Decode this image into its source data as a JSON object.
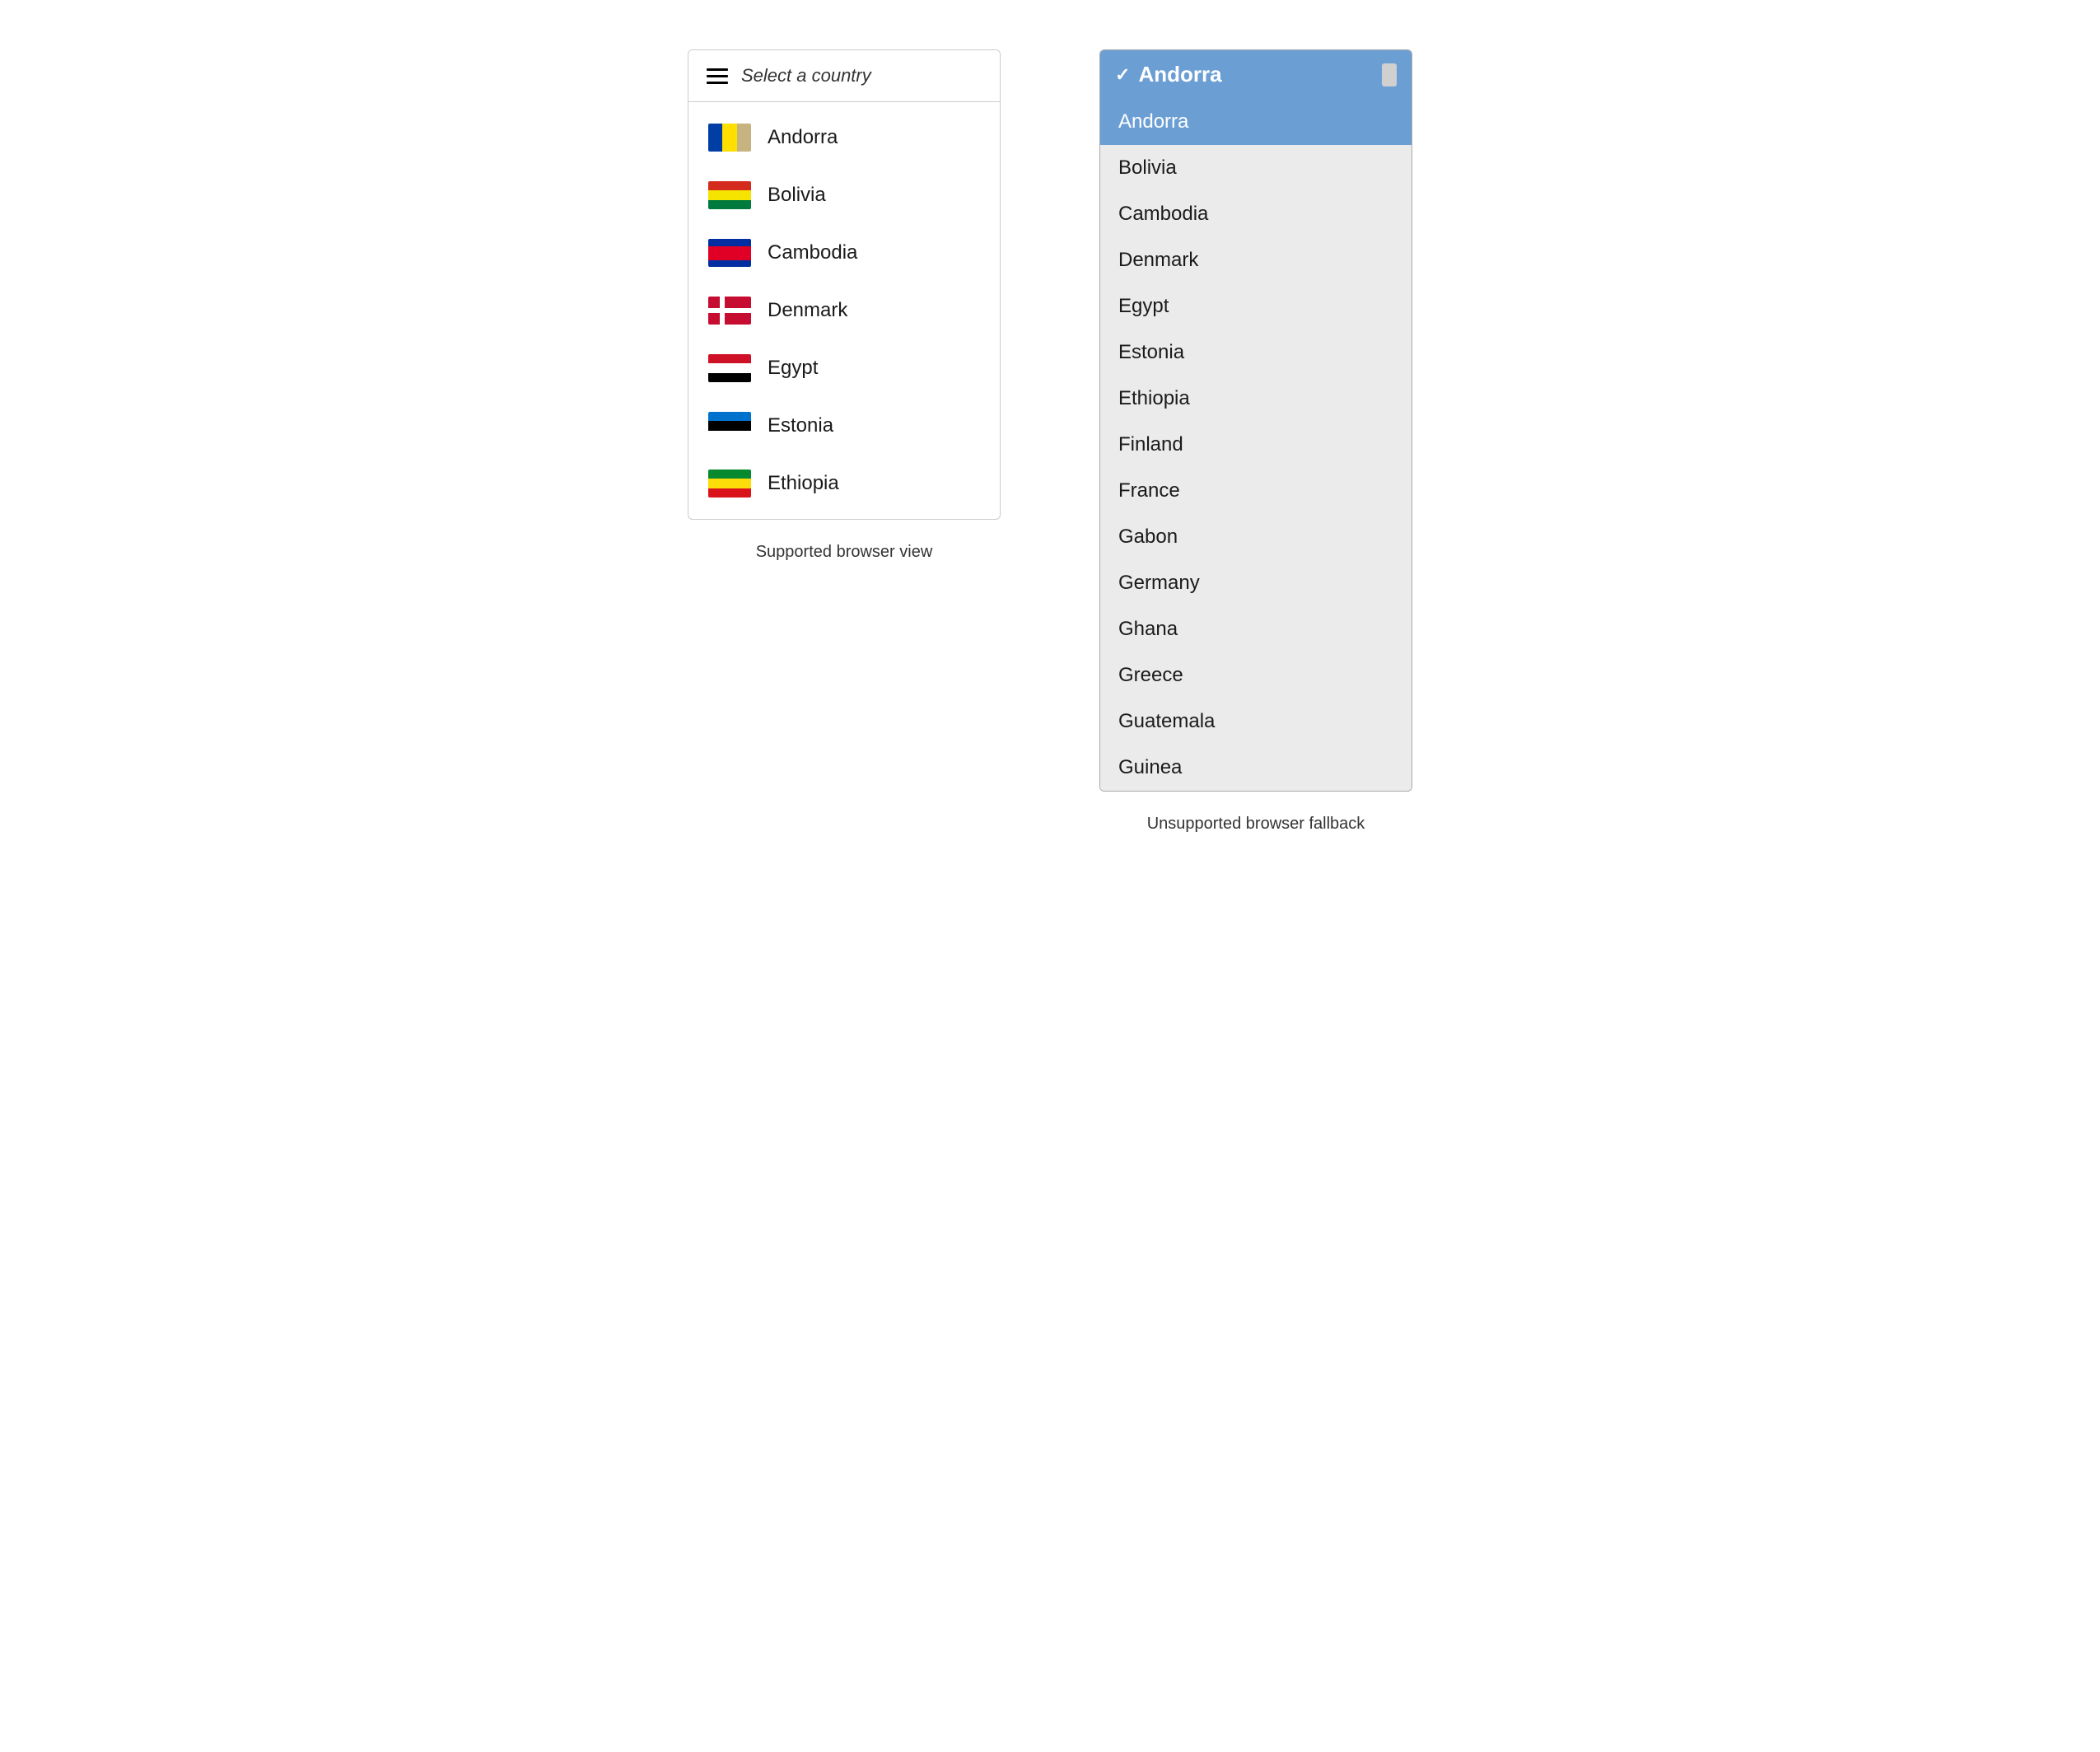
{
  "left": {
    "header": {
      "placeholder": "Select a country"
    },
    "label": "Supported browser view",
    "countries": [
      {
        "name": "Andorra",
        "code": "ad"
      },
      {
        "name": "Bolivia",
        "code": "bo"
      },
      {
        "name": "Cambodia",
        "code": "kh"
      },
      {
        "name": "Denmark",
        "code": "dk"
      },
      {
        "name": "Egypt",
        "code": "eg"
      },
      {
        "name": "Estonia",
        "code": "ee"
      },
      {
        "name": "Ethiopia",
        "code": "et"
      }
    ]
  },
  "right": {
    "label": "Unsupported browser fallback",
    "selected": "Andorra",
    "options": [
      "Andorra",
      "Bolivia",
      "Cambodia",
      "Denmark",
      "Egypt",
      "Estonia",
      "Ethiopia",
      "Finland",
      "France",
      "Gabon",
      "Germany",
      "Ghana",
      "Greece",
      "Guatemala",
      "Guinea"
    ]
  }
}
